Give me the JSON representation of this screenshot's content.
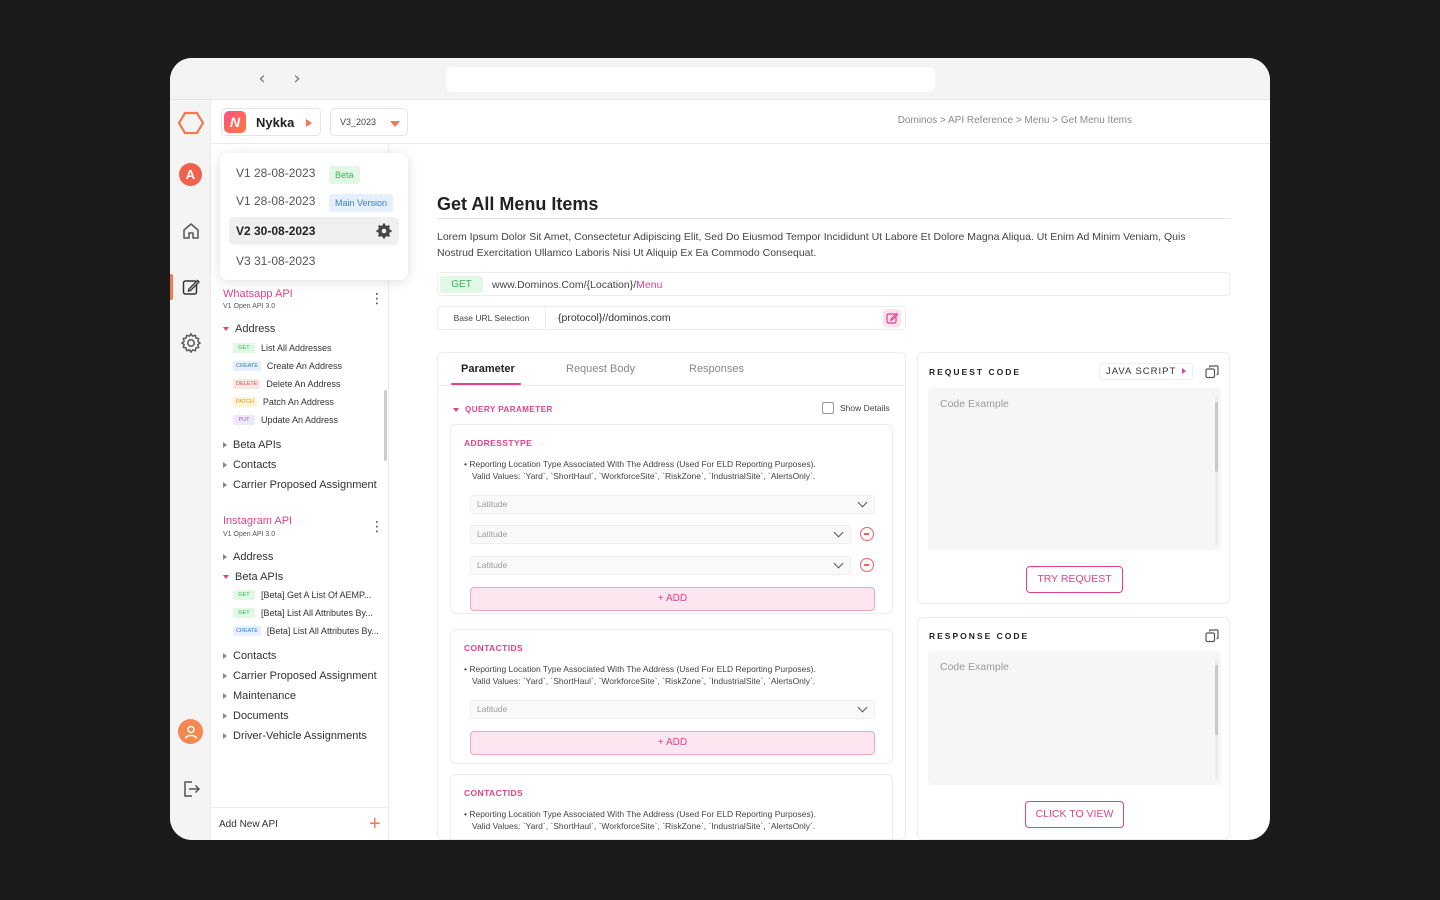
{
  "org": {
    "name": "Nykka",
    "logo_letter": "N"
  },
  "version": {
    "current": "V3_2023"
  },
  "breadcrumb": "Dominos  >  API Reference > Menu > Get Menu Items",
  "version_menu": [
    {
      "label": "V1 28-08-2023",
      "badge": "Beta"
    },
    {
      "label": "V1 28-08-2023",
      "badge": "Main Version"
    },
    {
      "label": "V2 30-08-2023",
      "badge": ""
    },
    {
      "label": "V3 31-08-2023",
      "badge": ""
    }
  ],
  "rail": {
    "avatar_letter": "A"
  },
  "sidebar": {
    "apis": [
      {
        "title": "Whatsapp API",
        "subtitle": "V1 Open API 3.0",
        "groups": [
          "Address",
          "Beta APIs",
          "Contacts",
          "Carrier Proposed Assignment"
        ],
        "endpoints": [
          {
            "method": "GET",
            "label": "List All Addresses"
          },
          {
            "method": "CREATE",
            "label": "Create An Address"
          },
          {
            "method": "DELETE",
            "label": "Delete An Address"
          },
          {
            "method": "PATCH",
            "label": "Patch An Address"
          },
          {
            "method": "PUT",
            "label": "Update An Address"
          }
        ]
      },
      {
        "title": "Instagram API",
        "subtitle": "V1 Open API 3.0",
        "groups": [
          "Address",
          "Beta APIs",
          "Contacts",
          "Carrier Proposed Assignment",
          "Maintenance",
          "Documents",
          "Driver-Vehicle Assignments"
        ],
        "endpoints": [
          {
            "method": "GET",
            "label": "[Beta] Get A List Of AEMP..."
          },
          {
            "method": "GET",
            "label": "[Beta] List All Attributes By..."
          },
          {
            "method": "CREATE",
            "label": "[Beta] List All Attributes By..."
          }
        ]
      }
    ],
    "add_new_api": "Add New API"
  },
  "main": {
    "title": "Get All Menu Items",
    "description": "Lorem Ipsum Dolor Sit Amet, Consectetur Adipiscing Elit, Sed Do Eiusmod Tempor Incididunt Ut Labore Et Dolore Magna Aliqua. Ut Enim Ad Minim Veniam, Quis Nostrud Exercitation Ullamco Laboris Nisi Ut Aliquip Ex Ea Commodo Consequat.",
    "method": "GET",
    "url_prefix": "www.Dominos.Com/{Location}/",
    "url_highlight": "Menu",
    "base_url_label": "Base URL Selection",
    "base_url_value": "{protocol}//dominos.com",
    "tabs": [
      "Parameter",
      "Request Body",
      "Responses"
    ],
    "query_parameter": "QUERY PARAMETER",
    "show_details": "Show Details",
    "params": [
      {
        "name": "ADDRESSTYPE",
        "desc_line1": "•  Reporting Location Type Associated With The Address (Used For ELD Reporting Purposes).",
        "desc_line2": "Valid Values: `Yard`, `ShortHaul`, `WorkforceSite`, `RiskZone`, `IndustrialSite`, `AlertsOnly`.",
        "selects": [
          "Latitude",
          "Latitude",
          "Latitude"
        ],
        "add_label": "+ ADD"
      },
      {
        "name": "CONTACTIDS",
        "desc_line1": "•  Reporting Location Type Associated With The Address (Used For ELD Reporting Purposes).",
        "desc_line2": "Valid Values: `Yard`, `ShortHaul`, `WorkforceSite`, `RiskZone`, `IndustrialSite`, `AlertsOnly`.",
        "selects": [
          "Latitude"
        ],
        "add_label": "+ ADD"
      },
      {
        "name": "CONTACTIDS",
        "desc_line1": "•  Reporting Location Type Associated With The Address (Used For ELD Reporting Purposes).",
        "desc_line2": "Valid Values: `Yard`, `ShortHaul`, `WorkforceSite`, `RiskZone`, `IndustrialSite`, `AlertsOnly`."
      }
    ]
  },
  "request_code": {
    "title": "REQUEST CODE",
    "language": "JAVA SCRIPT",
    "placeholder": "Code Example",
    "button": "TRY  REQUEST"
  },
  "response_code": {
    "title": "RESPONSE CODE",
    "placeholder": "Code Example",
    "button": "CLICK TO VIEW"
  },
  "colors": {
    "accent": "#e0428a",
    "brand_orange": "#f07a52",
    "get_green": "#3db35a"
  }
}
